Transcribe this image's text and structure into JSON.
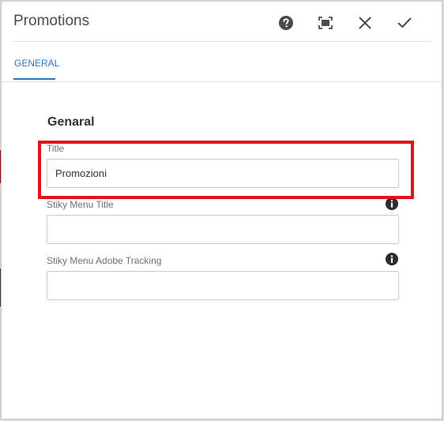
{
  "dialog": {
    "title": "Promotions",
    "actions": {
      "help_icon": "help-circle",
      "fullscreen_icon": "fullscreen",
      "close_icon": "close-x",
      "confirm_icon": "checkmark"
    }
  },
  "tabs": [
    {
      "label": "GENERAL",
      "active": true
    }
  ],
  "section": {
    "title": "Genaral"
  },
  "fields": [
    {
      "label": "Title",
      "value": "Promozioni",
      "placeholder": "",
      "info": false
    },
    {
      "label": "Stiky Menu Title",
      "value": "",
      "placeholder": "",
      "info": true
    },
    {
      "label": "Stiky Menu Adobe Tracking",
      "value": "",
      "placeholder": "",
      "info": true
    }
  ],
  "colors": {
    "accent": "#2d74c9",
    "highlight": "#e0141f"
  }
}
